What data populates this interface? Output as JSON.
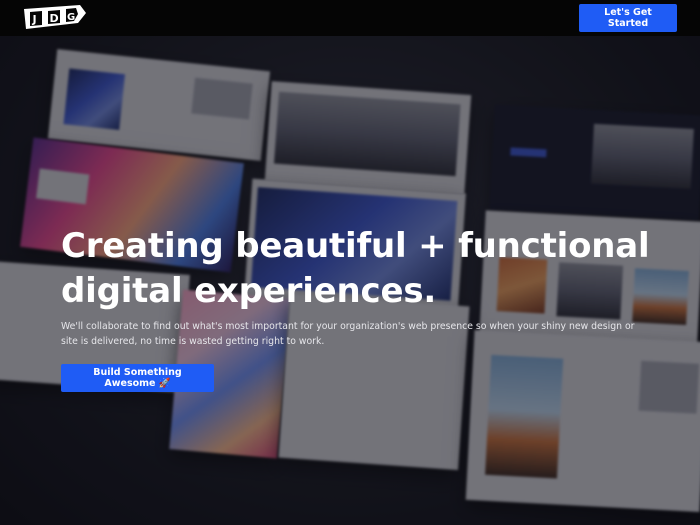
{
  "header": {
    "logo_icon": "jdg-pennant-logo",
    "cta_label": "Let's Get Started"
  },
  "hero": {
    "headline": "Creating beautiful + functional digital experiences.",
    "subtext": "We'll collaborate to find out what's most important for your organization's web presence so when your shiny new design or site is delivered, no time is wasted getting right to work.",
    "cta_label": "Build Something Awesome 🚀"
  },
  "colors": {
    "accent": "#1f5cf5",
    "header_bg": "#050505",
    "text": "#ffffff"
  }
}
